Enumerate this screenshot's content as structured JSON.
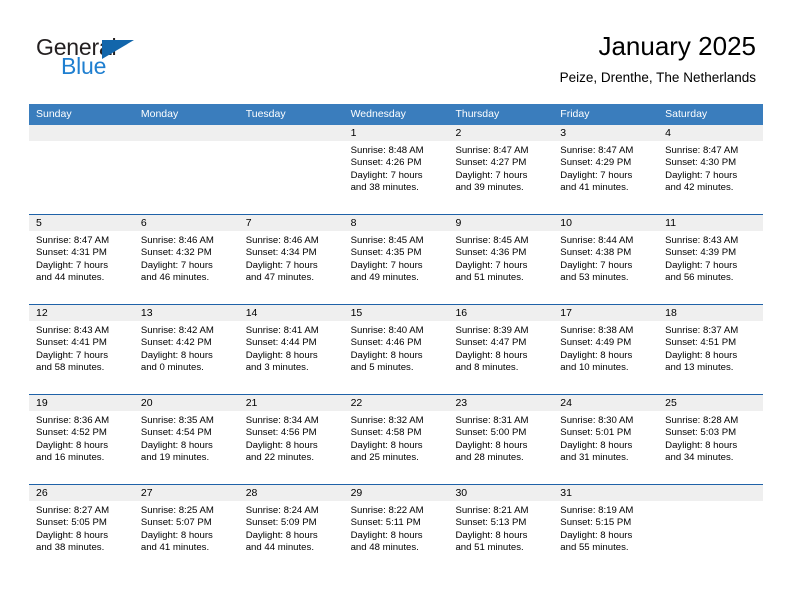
{
  "logo": {
    "word1": "General",
    "word2": "Blue",
    "triangle_color": "#1266ab",
    "word2_color": "#1f7fd0"
  },
  "header": {
    "title": "January 2025",
    "subtitle": "Peize, Drenthe, The Netherlands"
  },
  "theme": {
    "header_blue": "#3a7dbd",
    "divider_blue": "#1f62a8",
    "daynum_band": "#efefef"
  },
  "weekdays": [
    "Sunday",
    "Monday",
    "Tuesday",
    "Wednesday",
    "Thursday",
    "Friday",
    "Saturday"
  ],
  "weeks": [
    [
      {
        "day": "",
        "sunrise": "",
        "sunset": "",
        "daylight1": "",
        "daylight2": ""
      },
      {
        "day": "",
        "sunrise": "",
        "sunset": "",
        "daylight1": "",
        "daylight2": ""
      },
      {
        "day": "",
        "sunrise": "",
        "sunset": "",
        "daylight1": "",
        "daylight2": ""
      },
      {
        "day": "1",
        "sunrise": "Sunrise: 8:48 AM",
        "sunset": "Sunset: 4:26 PM",
        "daylight1": "Daylight: 7 hours",
        "daylight2": "and 38 minutes."
      },
      {
        "day": "2",
        "sunrise": "Sunrise: 8:47 AM",
        "sunset": "Sunset: 4:27 PM",
        "daylight1": "Daylight: 7 hours",
        "daylight2": "and 39 minutes."
      },
      {
        "day": "3",
        "sunrise": "Sunrise: 8:47 AM",
        "sunset": "Sunset: 4:29 PM",
        "daylight1": "Daylight: 7 hours",
        "daylight2": "and 41 minutes."
      },
      {
        "day": "4",
        "sunrise": "Sunrise: 8:47 AM",
        "sunset": "Sunset: 4:30 PM",
        "daylight1": "Daylight: 7 hours",
        "daylight2": "and 42 minutes."
      }
    ],
    [
      {
        "day": "5",
        "sunrise": "Sunrise: 8:47 AM",
        "sunset": "Sunset: 4:31 PM",
        "daylight1": "Daylight: 7 hours",
        "daylight2": "and 44 minutes."
      },
      {
        "day": "6",
        "sunrise": "Sunrise: 8:46 AM",
        "sunset": "Sunset: 4:32 PM",
        "daylight1": "Daylight: 7 hours",
        "daylight2": "and 46 minutes."
      },
      {
        "day": "7",
        "sunrise": "Sunrise: 8:46 AM",
        "sunset": "Sunset: 4:34 PM",
        "daylight1": "Daylight: 7 hours",
        "daylight2": "and 47 minutes."
      },
      {
        "day": "8",
        "sunrise": "Sunrise: 8:45 AM",
        "sunset": "Sunset: 4:35 PM",
        "daylight1": "Daylight: 7 hours",
        "daylight2": "and 49 minutes."
      },
      {
        "day": "9",
        "sunrise": "Sunrise: 8:45 AM",
        "sunset": "Sunset: 4:36 PM",
        "daylight1": "Daylight: 7 hours",
        "daylight2": "and 51 minutes."
      },
      {
        "day": "10",
        "sunrise": "Sunrise: 8:44 AM",
        "sunset": "Sunset: 4:38 PM",
        "daylight1": "Daylight: 7 hours",
        "daylight2": "and 53 minutes."
      },
      {
        "day": "11",
        "sunrise": "Sunrise: 8:43 AM",
        "sunset": "Sunset: 4:39 PM",
        "daylight1": "Daylight: 7 hours",
        "daylight2": "and 56 minutes."
      }
    ],
    [
      {
        "day": "12",
        "sunrise": "Sunrise: 8:43 AM",
        "sunset": "Sunset: 4:41 PM",
        "daylight1": "Daylight: 7 hours",
        "daylight2": "and 58 minutes."
      },
      {
        "day": "13",
        "sunrise": "Sunrise: 8:42 AM",
        "sunset": "Sunset: 4:42 PM",
        "daylight1": "Daylight: 8 hours",
        "daylight2": "and 0 minutes."
      },
      {
        "day": "14",
        "sunrise": "Sunrise: 8:41 AM",
        "sunset": "Sunset: 4:44 PM",
        "daylight1": "Daylight: 8 hours",
        "daylight2": "and 3 minutes."
      },
      {
        "day": "15",
        "sunrise": "Sunrise: 8:40 AM",
        "sunset": "Sunset: 4:46 PM",
        "daylight1": "Daylight: 8 hours",
        "daylight2": "and 5 minutes."
      },
      {
        "day": "16",
        "sunrise": "Sunrise: 8:39 AM",
        "sunset": "Sunset: 4:47 PM",
        "daylight1": "Daylight: 8 hours",
        "daylight2": "and 8 minutes."
      },
      {
        "day": "17",
        "sunrise": "Sunrise: 8:38 AM",
        "sunset": "Sunset: 4:49 PM",
        "daylight1": "Daylight: 8 hours",
        "daylight2": "and 10 minutes."
      },
      {
        "day": "18",
        "sunrise": "Sunrise: 8:37 AM",
        "sunset": "Sunset: 4:51 PM",
        "daylight1": "Daylight: 8 hours",
        "daylight2": "and 13 minutes."
      }
    ],
    [
      {
        "day": "19",
        "sunrise": "Sunrise: 8:36 AM",
        "sunset": "Sunset: 4:52 PM",
        "daylight1": "Daylight: 8 hours",
        "daylight2": "and 16 minutes."
      },
      {
        "day": "20",
        "sunrise": "Sunrise: 8:35 AM",
        "sunset": "Sunset: 4:54 PM",
        "daylight1": "Daylight: 8 hours",
        "daylight2": "and 19 minutes."
      },
      {
        "day": "21",
        "sunrise": "Sunrise: 8:34 AM",
        "sunset": "Sunset: 4:56 PM",
        "daylight1": "Daylight: 8 hours",
        "daylight2": "and 22 minutes."
      },
      {
        "day": "22",
        "sunrise": "Sunrise: 8:32 AM",
        "sunset": "Sunset: 4:58 PM",
        "daylight1": "Daylight: 8 hours",
        "daylight2": "and 25 minutes."
      },
      {
        "day": "23",
        "sunrise": "Sunrise: 8:31 AM",
        "sunset": "Sunset: 5:00 PM",
        "daylight1": "Daylight: 8 hours",
        "daylight2": "and 28 minutes."
      },
      {
        "day": "24",
        "sunrise": "Sunrise: 8:30 AM",
        "sunset": "Sunset: 5:01 PM",
        "daylight1": "Daylight: 8 hours",
        "daylight2": "and 31 minutes."
      },
      {
        "day": "25",
        "sunrise": "Sunrise: 8:28 AM",
        "sunset": "Sunset: 5:03 PM",
        "daylight1": "Daylight: 8 hours",
        "daylight2": "and 34 minutes."
      }
    ],
    [
      {
        "day": "26",
        "sunrise": "Sunrise: 8:27 AM",
        "sunset": "Sunset: 5:05 PM",
        "daylight1": "Daylight: 8 hours",
        "daylight2": "and 38 minutes."
      },
      {
        "day": "27",
        "sunrise": "Sunrise: 8:25 AM",
        "sunset": "Sunset: 5:07 PM",
        "daylight1": "Daylight: 8 hours",
        "daylight2": "and 41 minutes."
      },
      {
        "day": "28",
        "sunrise": "Sunrise: 8:24 AM",
        "sunset": "Sunset: 5:09 PM",
        "daylight1": "Daylight: 8 hours",
        "daylight2": "and 44 minutes."
      },
      {
        "day": "29",
        "sunrise": "Sunrise: 8:22 AM",
        "sunset": "Sunset: 5:11 PM",
        "daylight1": "Daylight: 8 hours",
        "daylight2": "and 48 minutes."
      },
      {
        "day": "30",
        "sunrise": "Sunrise: 8:21 AM",
        "sunset": "Sunset: 5:13 PM",
        "daylight1": "Daylight: 8 hours",
        "daylight2": "and 51 minutes."
      },
      {
        "day": "31",
        "sunrise": "Sunrise: 8:19 AM",
        "sunset": "Sunset: 5:15 PM",
        "daylight1": "Daylight: 8 hours",
        "daylight2": "and 55 minutes."
      },
      {
        "day": "",
        "sunrise": "",
        "sunset": "",
        "daylight1": "",
        "daylight2": ""
      }
    ]
  ]
}
